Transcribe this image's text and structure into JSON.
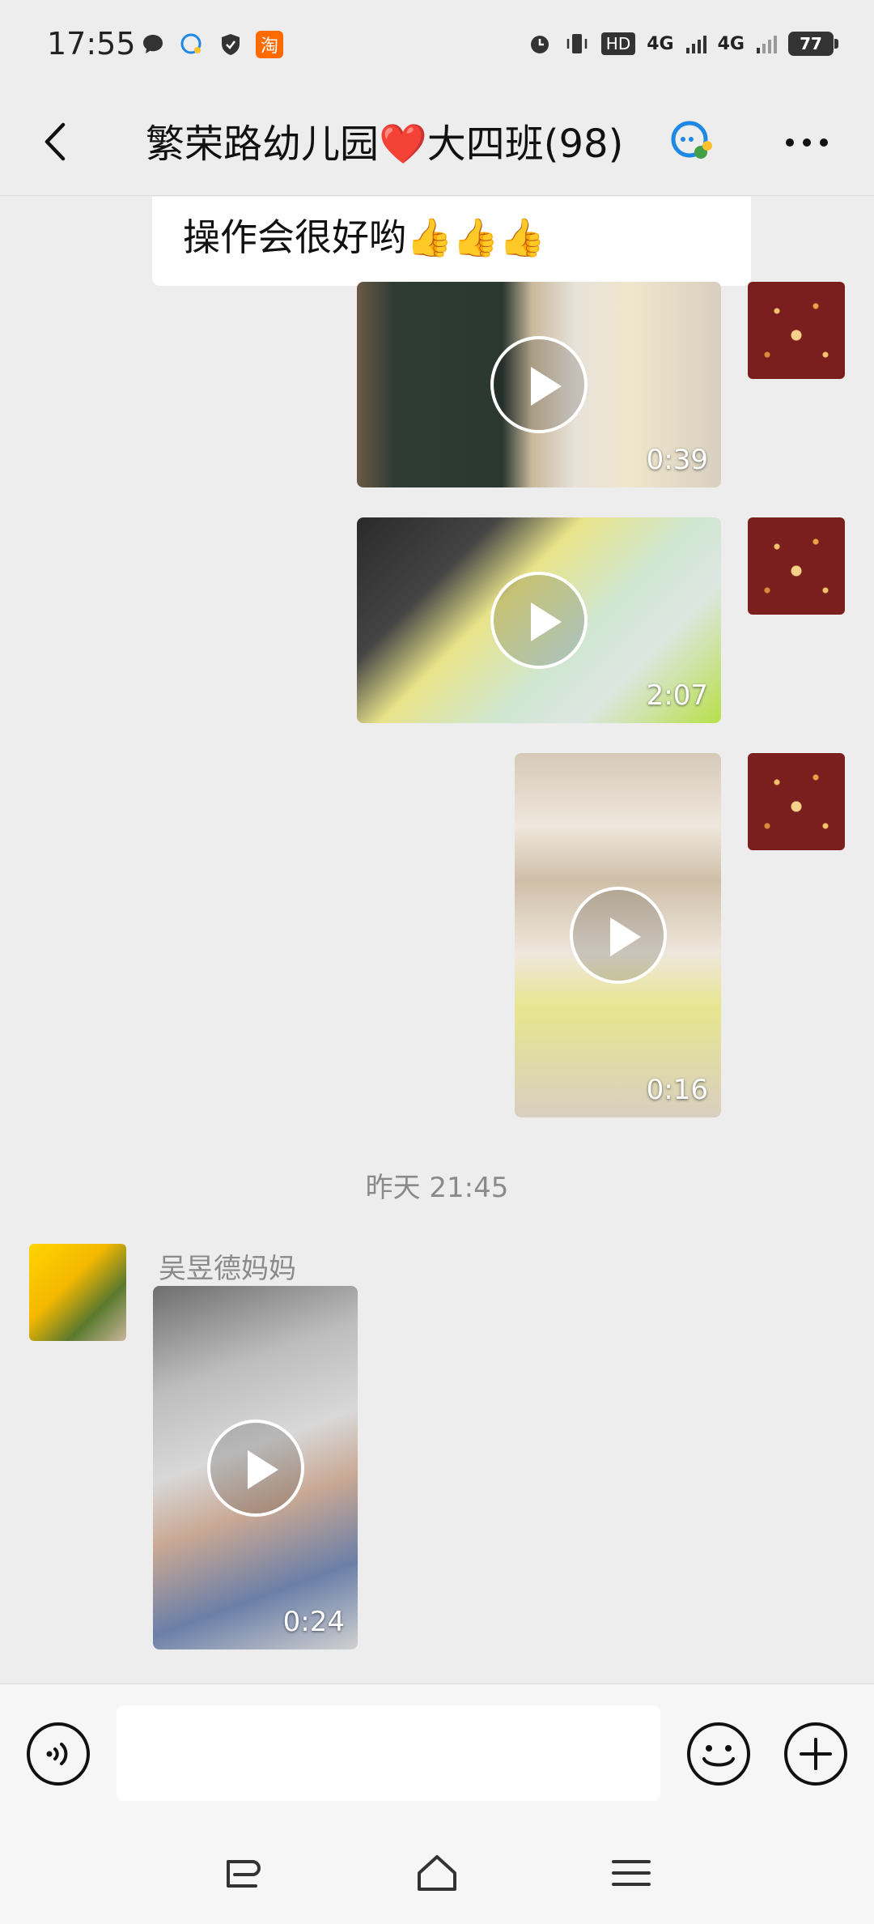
{
  "status_bar": {
    "time": "17:55",
    "left_icons": [
      "chat-bubble-icon",
      "qq-icon",
      "shield-icon",
      "taobao-icon"
    ],
    "taobao_label": "淘",
    "hd_label": "HD",
    "net1": "4G",
    "net2": "4G",
    "battery": "77"
  },
  "nav": {
    "title": "繁荣路幼儿园❤️大四班(98)"
  },
  "messages": {
    "text_bubble": "操作会很好哟👍👍👍",
    "videos_self": [
      {
        "duration": "0:39"
      },
      {
        "duration": "2:07"
      },
      {
        "duration": "0:16"
      }
    ],
    "divider": "昨天  21:45",
    "other_sender": "吴昱德妈妈",
    "video_other": {
      "duration": "0:24"
    }
  },
  "input": {
    "placeholder": ""
  }
}
